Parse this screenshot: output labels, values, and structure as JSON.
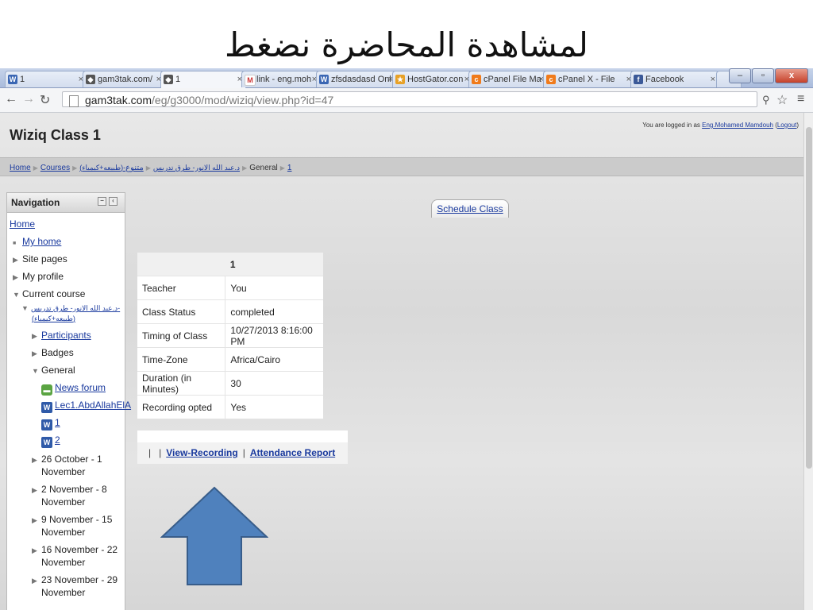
{
  "slide": {
    "title": "لمشاهدة المحاضرة نضغط"
  },
  "browser": {
    "tabs": [
      {
        "label": "1",
        "icon": "wiziq-icon"
      },
      {
        "label": "gam3tak.com/",
        "icon": "moodle-icon"
      },
      {
        "label": "1",
        "icon": "moodle-icon"
      },
      {
        "label": "link - eng.moh",
        "icon": "gmail-icon"
      },
      {
        "label": "zfsdasdasd Onl",
        "icon": "wiziq-icon"
      },
      {
        "label": "HostGator.con",
        "icon": "hostgator-icon"
      },
      {
        "label": "cPanel File Ma",
        "icon": "cpanel-icon"
      },
      {
        "label": "cPanel X - File",
        "icon": "cpanel-icon"
      },
      {
        "label": "Facebook",
        "icon": "facebook-icon"
      }
    ],
    "close_glyph": "×",
    "url_domain": "gam3tak.com",
    "url_path": "/eg/g3000/mod/wiziq/view.php?id=47",
    "window_buttons": {
      "minimize": "–",
      "maximize": "▫",
      "close": "x"
    }
  },
  "page": {
    "site_title": "Wiziq Class 1",
    "login": {
      "prefix": "You are logged in as",
      "user": "Eng.Mohamed Mamdouh",
      "logout": "Logout"
    },
    "breadcrumb": {
      "home": "Home",
      "courses": "Courses",
      "cat": "(طبيعه+كيمياء)-د.عبد الله الانور- طرق تدريس",
      "course": "متنوع",
      "section": "General",
      "item": "1"
    },
    "nav": {
      "title": "Navigation",
      "home": "Home",
      "my_home": "My home",
      "site_pages": "Site pages",
      "my_profile": "My profile",
      "current_course": "Current course",
      "course_line1": "د.عبد الله الانور- طرق تدريس-",
      "course_line2": "(طبيعه+كيمياء)",
      "participants": "Participants",
      "badges": "Badges",
      "general": "General",
      "news_forum": "News forum",
      "lec1": "Lec1.AbdAllahElA",
      "item1": "1",
      "item2": "2",
      "weeks": [
        [
          "26 October - 1",
          "November"
        ],
        [
          "2 November - 8",
          "November"
        ],
        [
          "9 November - 15",
          "November"
        ],
        [
          "16 November - 22",
          "November"
        ],
        [
          "23 November - 29",
          "November"
        ]
      ]
    },
    "schedule_label": "Schedule Class",
    "table": {
      "header": "1",
      "rows": [
        {
          "label": "Teacher",
          "value": "You"
        },
        {
          "label": "Class Status",
          "value": "completed"
        },
        {
          "label": "Timing of Class",
          "value": "10/27/2013 8:16:00 PM"
        },
        {
          "label": "Time-Zone",
          "value": "Africa/Cairo"
        },
        {
          "label": "Duration (in Minutes)",
          "value": "30"
        },
        {
          "label": "Recording opted",
          "value": "Yes"
        }
      ]
    },
    "actions": {
      "view_recording": "View-Recording",
      "attendance": "Attendance Report"
    }
  },
  "colors": {
    "arrow_fill": "#4f81bd",
    "arrow_stroke": "#385d8a",
    "link": "#1a3a9e"
  }
}
